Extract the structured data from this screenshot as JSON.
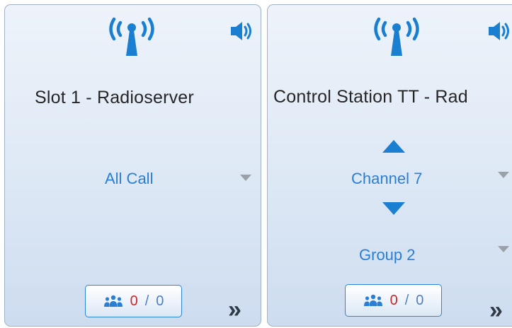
{
  "cards": [
    {
      "name": "Slot 1 - Radioserver",
      "talkgroup": "All Call",
      "counter": {
        "active": "0",
        "separator": "/",
        "total": "0"
      },
      "expand_glyph": "»",
      "icons": [
        "antenna-icon",
        "speaker-icon",
        "dropdown-arrow-icon",
        "users-icon"
      ]
    },
    {
      "name": "Control Station TT - Rad",
      "channel": "Channel 7",
      "talkgroup": "Group 2",
      "counter": {
        "active": "0",
        "separator": "/",
        "total": "0"
      },
      "expand_glyph": "»",
      "icons": [
        "antenna-icon",
        "speaker-icon",
        "channel-up-icon",
        "channel-down-icon",
        "dropdown-arrow-icon",
        "users-icon"
      ]
    }
  ],
  "colors": {
    "accent_blue": "#1b7fd1",
    "link_blue": "#2a7fd4",
    "active_count_red": "#c62828",
    "card_border": "#9fb2c6"
  }
}
